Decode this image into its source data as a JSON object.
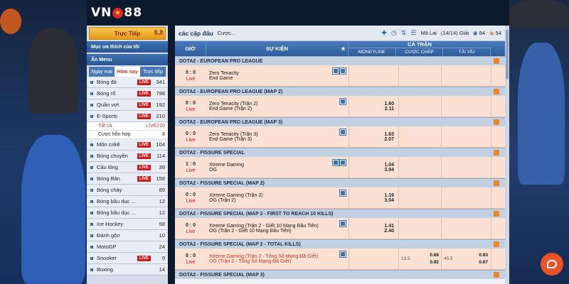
{
  "brand": {
    "left": "VN",
    "right": "88",
    "star": "★"
  },
  "sidebar": {
    "live_label": "Trực Tiếp",
    "live_count": "0",
    "favorites_label": "Mục ưa thích của tôi",
    "hide_menu_label": "Ẩn Menu",
    "tabs": [
      "Ngày mai",
      "Hôm nay",
      "Trực tiếp"
    ],
    "live_badge": "LIVE",
    "sports": [
      {
        "name": "Bóng đá",
        "live": true,
        "count": "341"
      },
      {
        "name": "Bóng rổ",
        "live": true,
        "count": "798"
      },
      {
        "name": "Quần vợt",
        "live": true,
        "count": "192"
      },
      {
        "name": "E-Sports",
        "live": true,
        "count": "210"
      }
    ],
    "esports_sub": [
      {
        "name": "Tất cả",
        "live": true,
        "count": "210"
      },
      {
        "name": "Cược hỗn hợp",
        "live": false,
        "count": "8"
      }
    ],
    "sports2": [
      {
        "name": "Môn crikê",
        "live": true,
        "count": "104"
      },
      {
        "name": "Bóng chuyền",
        "live": true,
        "count": "114"
      },
      {
        "name": "Cầu lông",
        "live": true,
        "count": "39"
      },
      {
        "name": "Bóng Bàn",
        "live": true,
        "count": "158"
      },
      {
        "name": "Bóng chày",
        "live": false,
        "count": "89"
      },
      {
        "name": "Bóng bầu dục ...",
        "live": false,
        "count": "12"
      },
      {
        "name": "Bóng bầu dục ...",
        "live": false,
        "count": "12"
      },
      {
        "name": "Ice Hockey",
        "live": false,
        "count": "58"
      },
      {
        "name": "Đánh gôn",
        "live": false,
        "count": "10"
      },
      {
        "name": "MotoGP",
        "live": false,
        "count": "24"
      },
      {
        "name": "Snooker",
        "live": true,
        "count": "9"
      },
      {
        "name": "Boxing",
        "live": false,
        "count": "14"
      }
    ]
  },
  "toolbar": {
    "title": "các cặp đấu",
    "bet_label": "Cược...",
    "odds_type": "Mã Lai",
    "page": "(14/14) Giải",
    "count1": "84",
    "count2": "54"
  },
  "table": {
    "col_time": "GIỜ",
    "col_event": "SỰ KIỆN",
    "col_fulltime": "CẢ TRẬN",
    "col_moneyline": "MONEYLINE",
    "col_handicap": "CƯỢC CHẤP",
    "col_overunder": "TÀI XỈU"
  },
  "rows": [
    {
      "type": "league",
      "name": "DOTA2 - EUROPEAN PRO LEAGUE"
    },
    {
      "type": "match",
      "score": "0 : 0",
      "live": "Live",
      "home": "Zero Tenacity",
      "away": "End Game",
      "icons": 2,
      "ml_home": "",
      "ml_away": ""
    },
    {
      "type": "league",
      "name": "DOTA2 - EUROPEAN PRO LEAGUE (MAP 2)"
    },
    {
      "type": "match",
      "score": "0 : 0",
      "live": "Live",
      "home": "Zero Tenacity (Trận 2)",
      "away": "End Game (Trận 2)",
      "icons": 1,
      "ml_home": "1.60",
      "ml_away": "2.11"
    },
    {
      "type": "league",
      "name": "DOTA2 - EUROPEAN PRO LEAGUE (MAP 3)"
    },
    {
      "type": "match",
      "score": "0 : 0",
      "live": "Live",
      "home": "Zero Tenacity (Trận 3)",
      "away": "End Game (Trận 3)",
      "icons": 1,
      "ml_home": "1.63",
      "ml_away": "2.07"
    },
    {
      "type": "league",
      "name": "DOTA2 - FISSURE SPECIAL"
    },
    {
      "type": "match",
      "score": "1 : 0",
      "live": "Live",
      "home": "Xtreme Gaming",
      "away": "OG",
      "icons": 2,
      "ml_home": "1.04",
      "ml_away": "3.94"
    },
    {
      "type": "league",
      "name": "DOTA2 - FISSURE SPECIAL (MAP 2)"
    },
    {
      "type": "match",
      "score": "0 : 0",
      "live": "Live",
      "home": "Xtreme Gaming (Trận 2)",
      "away": "OG (Trận 2)",
      "icons": 1,
      "ml_home": "1.19",
      "ml_away": "3.04"
    },
    {
      "type": "league",
      "name": "DOTA2 - FISSURE SPECIAL (MAP 2 - FIRST TO REACH 10 KILLS)"
    },
    {
      "type": "match",
      "score": "0 : 0",
      "live": "Live",
      "home": "Xtreme Gaming (Trận 2 - Giết 10 Mạng Đầu Tiên)",
      "away": "OG (Trận 2 - Giết 10 Mạng Đầu Tiên)",
      "icons": 1,
      "ml_home": "1.41",
      "ml_away": "2.40"
    },
    {
      "type": "league",
      "name": "DOTA2 - FISSURE SPECIAL (MAP 2 - TOTAL KILLS)"
    },
    {
      "type": "match",
      "score": "0 : 0",
      "live": "Live",
      "home": "Xtreme Gaming (Trận 2 - Tổng Số Mạng Đã Giết)",
      "away": "OG (Trận 2 - Tổng Số Mạng Đã Giết)",
      "icons": 1,
      "red": true,
      "ml_home": "",
      "ml_away": "",
      "hc_line": "13.5",
      "hc_home": "0.68",
      "hc_away": "0.92",
      "ou_line": "45.5",
      "ou_home": "0.93",
      "ou_away": "0.67"
    },
    {
      "type": "league",
      "name": "DOTA2 - FISSURE SPECIAL (MAP 3)"
    }
  ]
}
